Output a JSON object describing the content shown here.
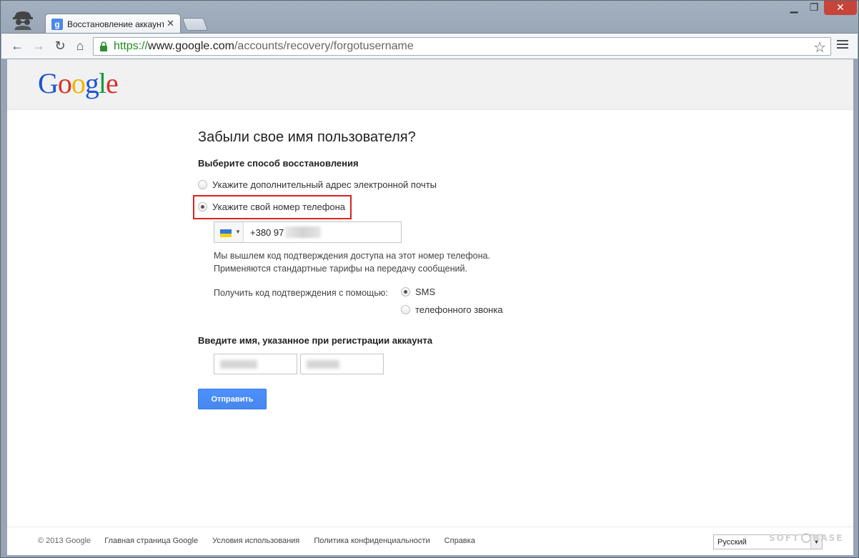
{
  "browser": {
    "tab_title": "Восстановление аккаунта",
    "favicon_letter": "g",
    "tab_close": "✕",
    "minimize": "▁",
    "maximize": "❐",
    "close": "✕",
    "url_scheme": "https://",
    "url_host": "www.google.com",
    "url_path": "/accounts/recovery/forgotusername"
  },
  "logo": {
    "g1": "G",
    "o1": "o",
    "o2": "o",
    "g2": "g",
    "l": "l",
    "e": "e"
  },
  "form": {
    "title": "Забыли свое имя пользователя?",
    "method_heading": "Выберите способ восстановления",
    "option_email": "Укажите дополнительный адрес электронной почты",
    "option_phone": "Укажите свой номер телефона",
    "phone_value": "+380 97",
    "note_line1": "Мы вышлем код подтверждения доступа на этот номер телефона.",
    "note_line2": "Применяются стандартные тарифы на передачу сообщений.",
    "receive_via": "Получить код подтверждения с помощью:",
    "via_sms": "SMS",
    "via_call": "телефонного звонка",
    "name_heading": "Введите имя, указанное при регистрации аккаунта",
    "submit": "Отправить"
  },
  "footer": {
    "copyright": "© 2013 Google",
    "links": [
      "Главная страница Google",
      "Условия использования",
      "Политика конфиденциальности",
      "Справка"
    ],
    "language": "Русский"
  },
  "watermark": {
    "left": "SOFT",
    "right": "BASE"
  }
}
